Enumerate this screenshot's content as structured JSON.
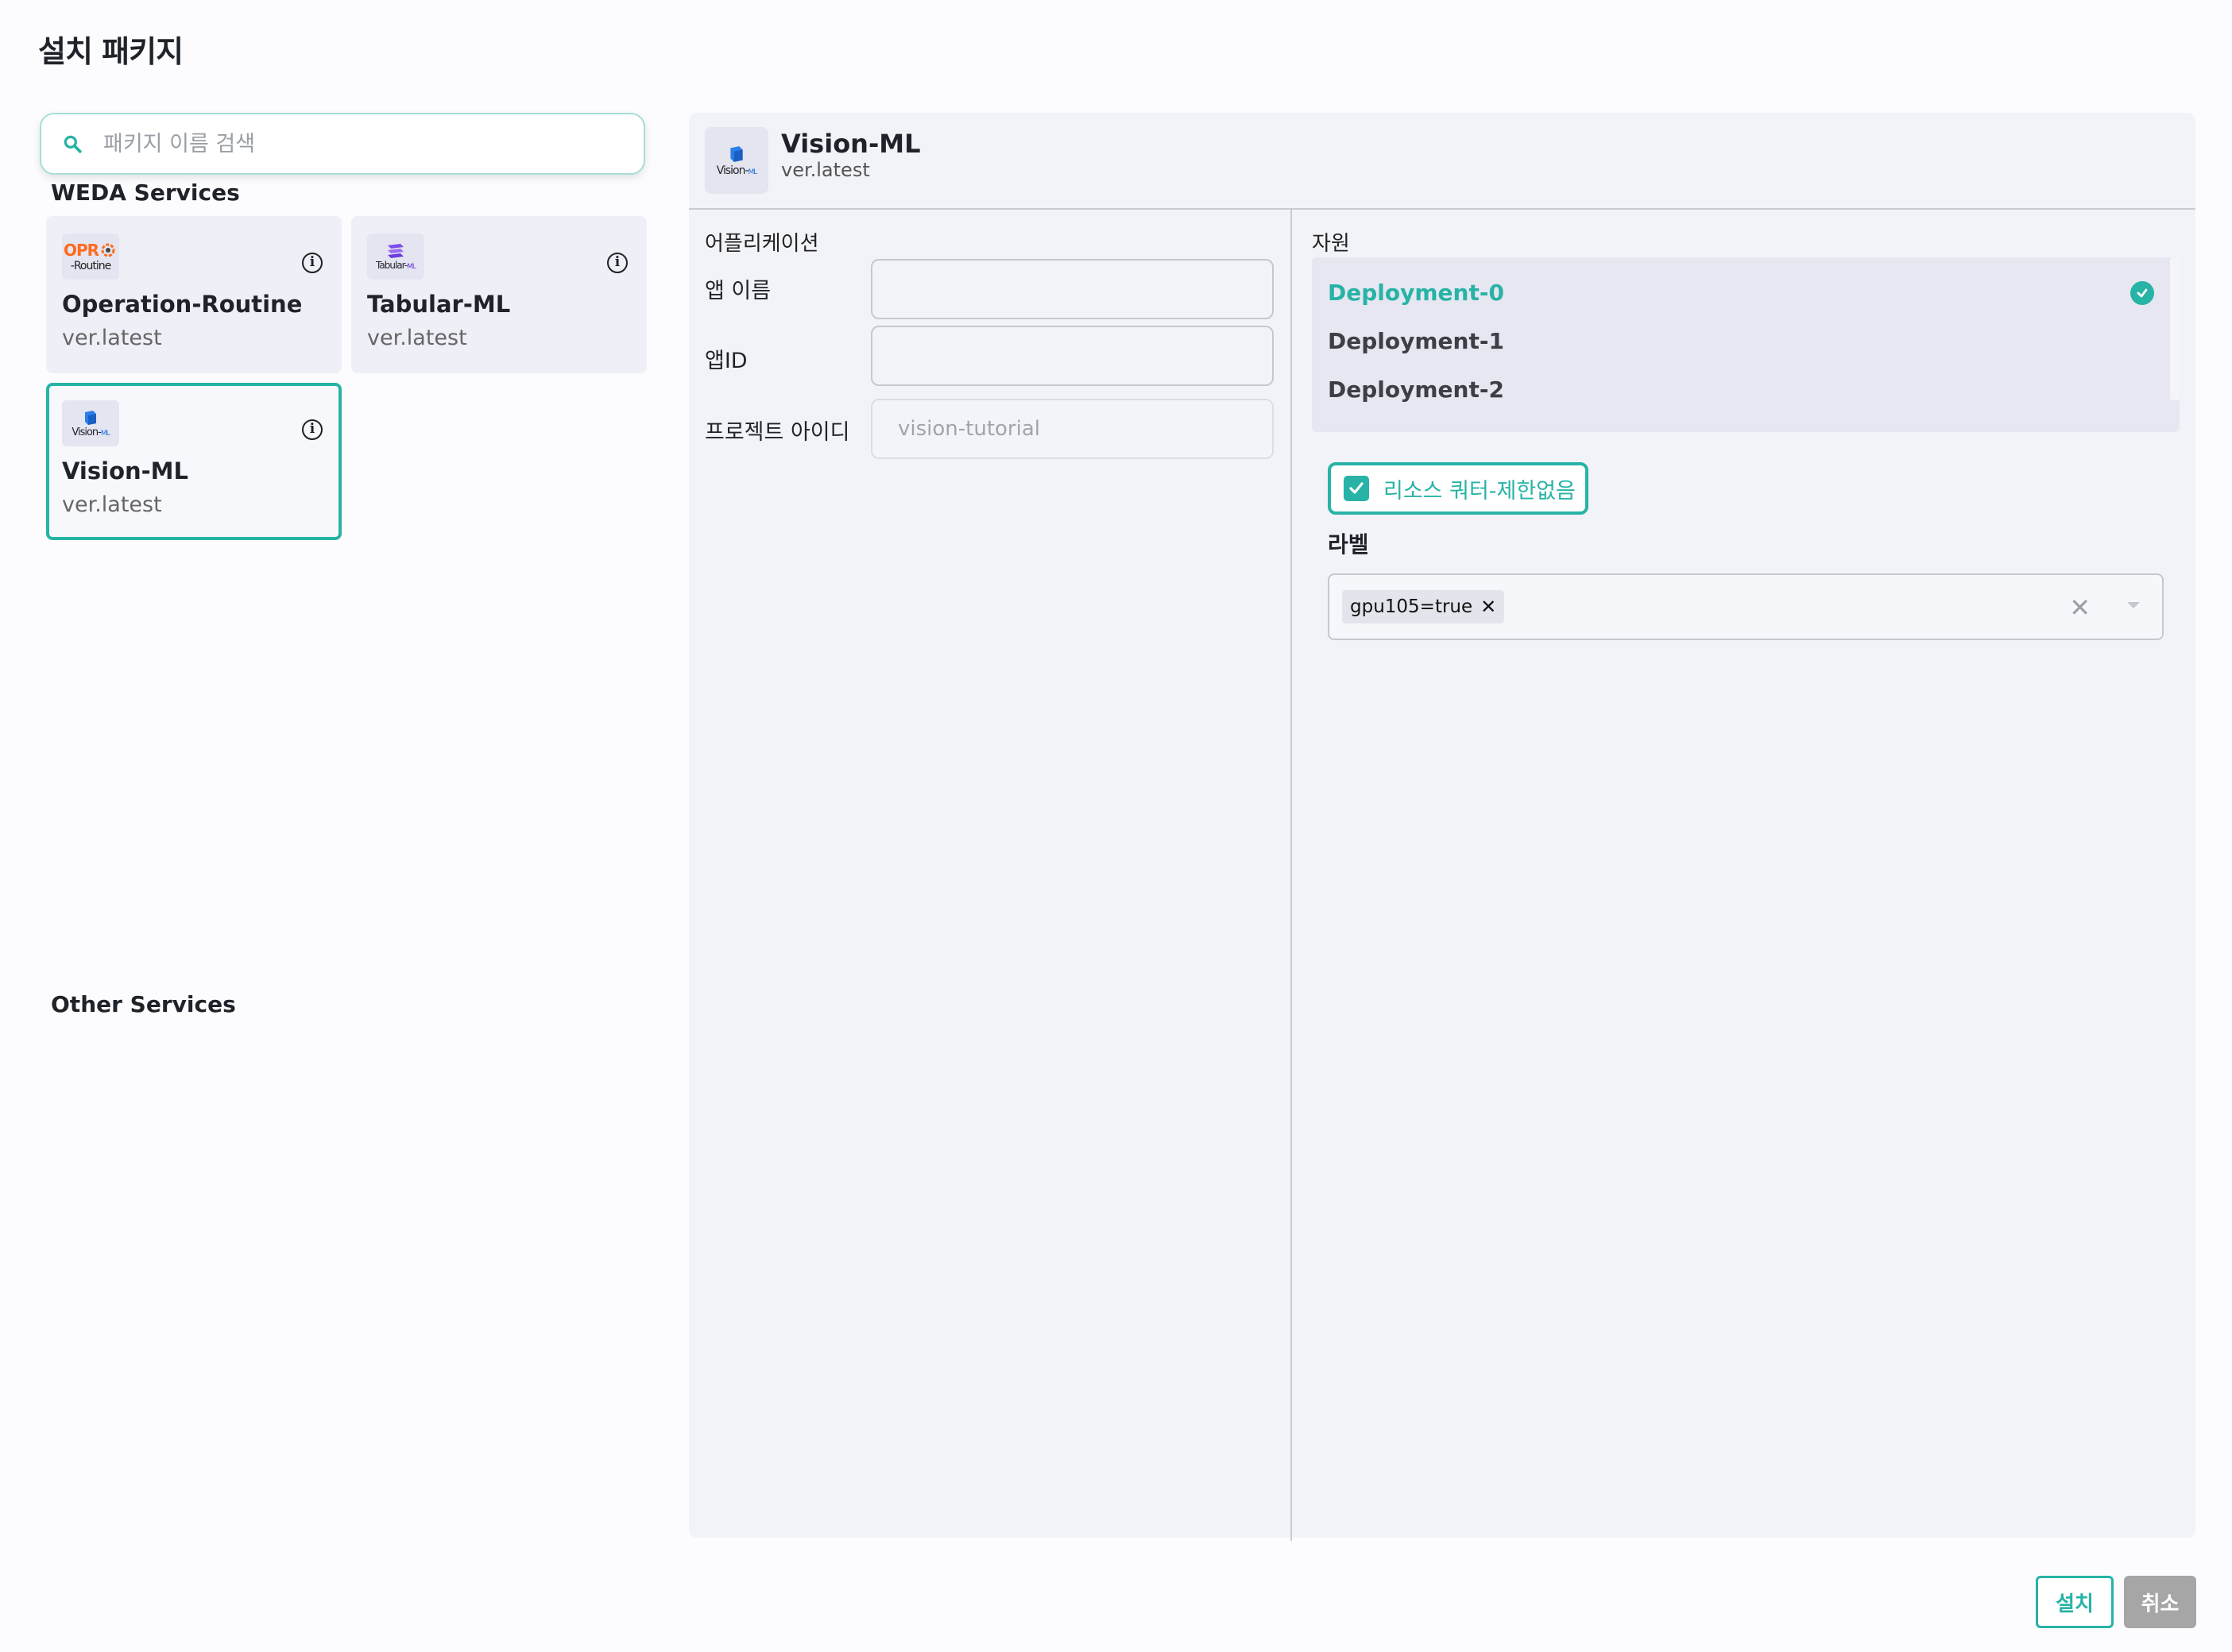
{
  "page": {
    "title": "설치 패키지"
  },
  "search": {
    "placeholder": "패키지 이름 검색",
    "value": ""
  },
  "sections": {
    "weda": "WEDA Services",
    "other": "Other Services"
  },
  "packages": [
    {
      "name": "Operation-Routine",
      "version": "ver.latest",
      "logo_text": "OPR",
      "logo_sub": "-Routine",
      "selected": false
    },
    {
      "name": "Tabular-ML",
      "version": "ver.latest",
      "logo_text": "Tabular",
      "logo_sub": "ML",
      "selected": false
    },
    {
      "name": "Vision-ML",
      "version": "ver.latest",
      "logo_text": "Vision",
      "logo_sub": "ML",
      "selected": true
    }
  ],
  "detail": {
    "name": "Vision-ML",
    "version": "ver.latest",
    "logo_text": "Vision",
    "logo_sub": "ML",
    "app_section": "어플리케이션",
    "resource_section": "자원",
    "fields": {
      "app_name_label": "앱 이름",
      "app_name_value": "",
      "app_id_label": "앱ID",
      "app_id_value": "",
      "project_label": "프로젝트 아이디",
      "project_value": "vision-tutorial"
    },
    "deployments": [
      "Deployment-0",
      "Deployment-1",
      "Deployment-2"
    ],
    "selected_deployment": "Deployment-0",
    "quota_checkbox": {
      "label": "리소스 쿼터-제한없음",
      "checked": true
    },
    "label_title": "라벨",
    "labels": [
      "gpu105=true"
    ]
  },
  "buttons": {
    "install": "설치",
    "cancel": "취소"
  },
  "colors": {
    "accent": "#27b3a6",
    "cancel_bg": "#a6a6a6"
  }
}
